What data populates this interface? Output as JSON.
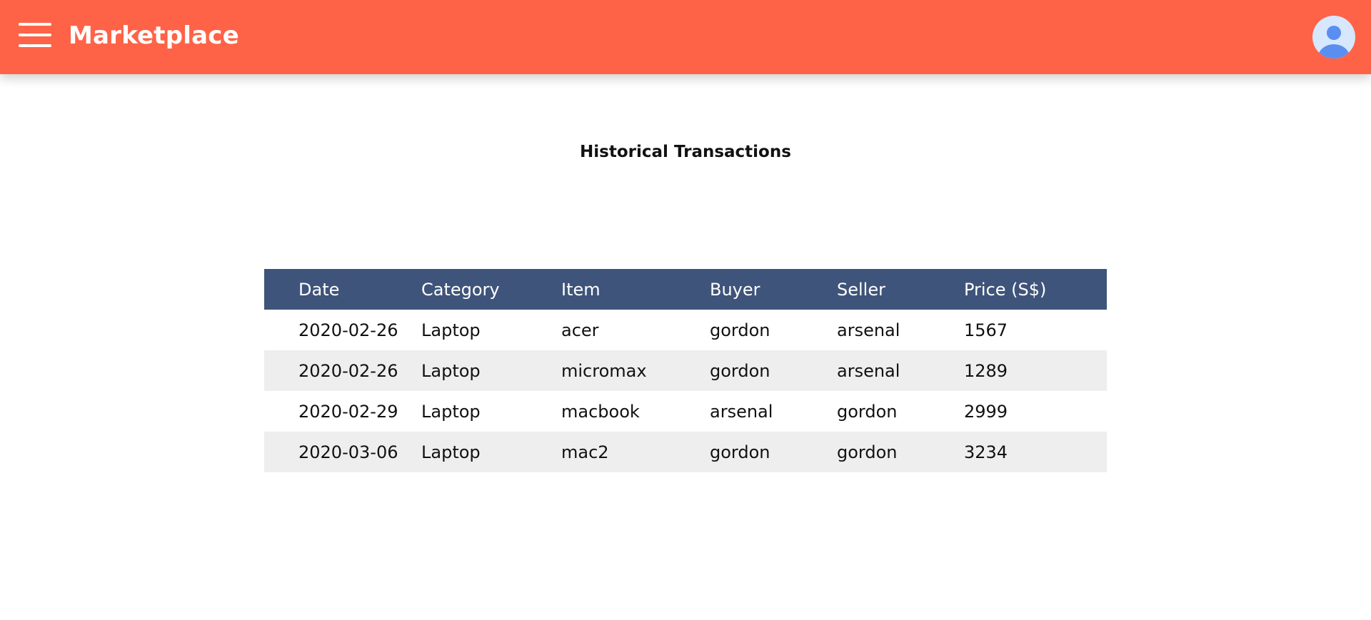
{
  "header": {
    "title": "Marketplace",
    "menu_icon": "hamburger-menu-icon",
    "avatar_icon": "user-avatar-icon",
    "background_color": "#ff6347"
  },
  "main": {
    "title": "Historical Transactions"
  },
  "table": {
    "header_color": "#3f547a",
    "stripe_color": "#eeeeee",
    "columns": [
      "Date",
      "Category",
      "Item",
      "Buyer",
      "Seller",
      "Price (S$)"
    ],
    "rows": [
      [
        "2020-02-26",
        "Laptop",
        "acer",
        "gordon",
        "arsenal",
        "1567"
      ],
      [
        "2020-02-26",
        "Laptop",
        "micromax",
        "gordon",
        "arsenal",
        "1289"
      ],
      [
        "2020-02-29",
        "Laptop",
        "macbook",
        "arsenal",
        "gordon",
        "2999"
      ],
      [
        "2020-03-06",
        "Laptop",
        "mac2",
        "gordon",
        "gordon",
        "3234"
      ]
    ]
  }
}
